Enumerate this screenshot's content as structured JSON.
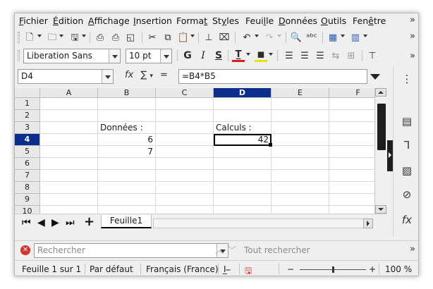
{
  "menu": [
    {
      "pre": "",
      "u": "F",
      "post": "ichier"
    },
    {
      "pre": "",
      "u": "É",
      "post": "dition"
    },
    {
      "pre": "",
      "u": "A",
      "post": "ffichage"
    },
    {
      "pre": "",
      "u": "I",
      "post": "nsertion"
    },
    {
      "pre": "Forma",
      "u": "t",
      "post": ""
    },
    {
      "pre": "St",
      "u": "y",
      "post": "les"
    },
    {
      "pre": "Feui",
      "u": "l",
      "post": "le"
    },
    {
      "pre": "",
      "u": "D",
      "post": "onnées"
    },
    {
      "pre": "",
      "u": "O",
      "post": "utils"
    },
    {
      "pre": "Fen",
      "u": "ê",
      "post": "tre"
    }
  ],
  "menu_more": "»",
  "toolbar": {
    "font_name": "Liberation Sans",
    "font_size": "10 pt",
    "bold": "G",
    "italic": "I",
    "underline": "S"
  },
  "formula_bar": {
    "name_box": "D4",
    "fx": "fx",
    "sum": "∑",
    "equals": "=",
    "formula": "=B4*B5"
  },
  "columns": [
    "A",
    "B",
    "C",
    "D",
    "E",
    "F"
  ],
  "active_column": "D",
  "rows": [
    "1",
    "2",
    "3",
    "4",
    "5",
    "6",
    "7",
    "8",
    "9",
    "10"
  ],
  "active_row": "4",
  "cells": {
    "B3": "Données :",
    "D3": "Calculs :",
    "B4": "6",
    "B5": "7",
    "D4": "42"
  },
  "sheet_tabs": [
    "Feuille1"
  ],
  "find": {
    "placeholder": "Rechercher",
    "find_all": "Tout rechercher"
  },
  "status": {
    "sheet": "Feuille 1 sur 1",
    "style": "Par défaut",
    "language": "Français (France)",
    "zoom_minus": "−",
    "zoom_plus": "+",
    "zoom": "100 %"
  },
  "colors": {
    "active_header": "#0b2d8c",
    "close_red": "#d9312f",
    "font_color_bar": "#d92020",
    "highlight_bar": "#f0e000"
  }
}
